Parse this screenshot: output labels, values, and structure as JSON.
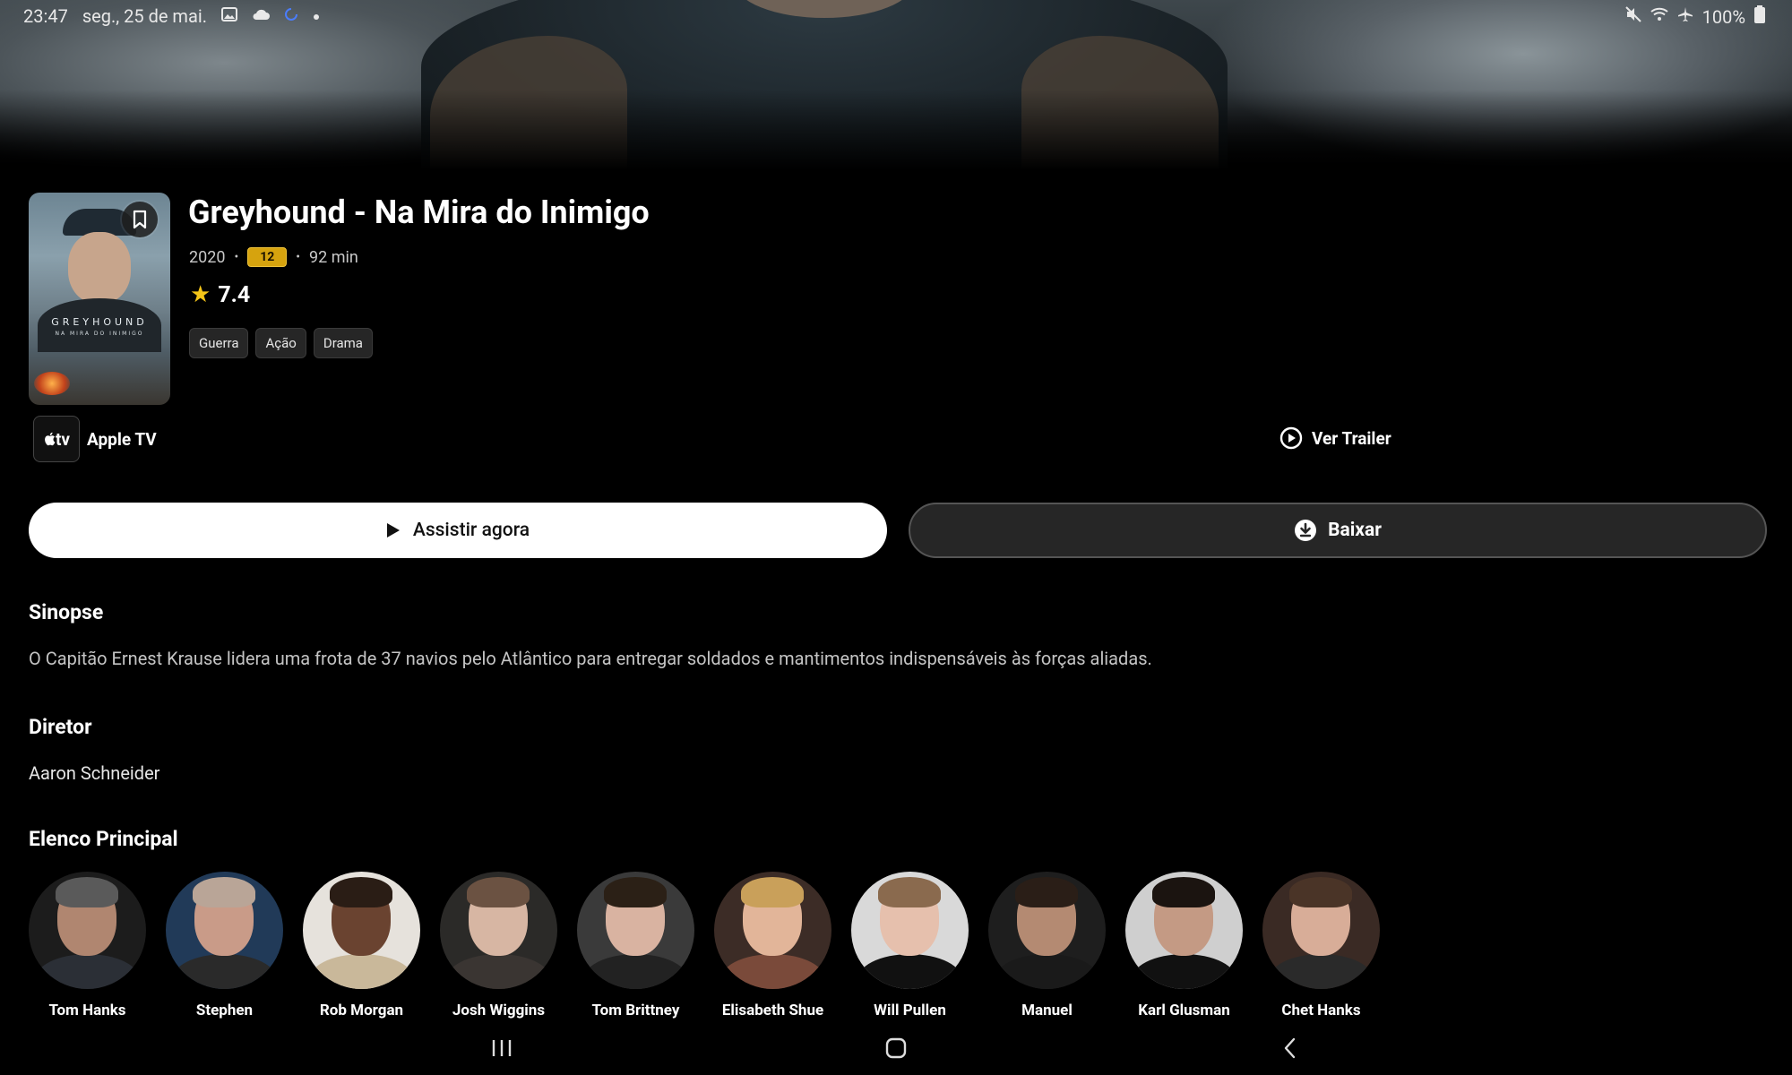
{
  "status_bar": {
    "time": "23:47",
    "date": "seg., 25 de mai.",
    "icons_left": [
      "image-icon",
      "cloud-icon",
      "sync-icon",
      "dot-icon"
    ],
    "icons_right": [
      "mute-icon",
      "wifi-icon",
      "airplane-icon",
      "battery-icon"
    ],
    "battery": "100%"
  },
  "movie": {
    "title": "Greyhound - Na Mira do Inimigo",
    "year": "2020",
    "age_rating": "12",
    "duration": "92 min",
    "rating": "7.4",
    "genres": [
      "Guerra",
      "Ação",
      "Drama"
    ],
    "poster_title": "GREYHOUND",
    "poster_subtitle": "NA MIRA DO INIMIGO"
  },
  "provider": {
    "logo_text": "tv",
    "name": "Apple TV"
  },
  "trailer": {
    "label": "Ver Trailer"
  },
  "actions": {
    "watch_label": "Assistir agora",
    "download_label": "Baixar"
  },
  "sections": {
    "synopsis_title": "Sinopse",
    "synopsis_text": "O Capitão Ernest Krause lidera uma frota de 37 navios pelo Atlântico para entregar soldados e mantimentos indispensáveis às forças aliadas.",
    "director_title": "Diretor",
    "director_name": "Aaron Schneider",
    "cast_title": "Elenco Principal"
  },
  "cast": [
    {
      "name": "Tom Hanks",
      "bg": "#1c1c1c",
      "skin": "#b08670",
      "hair": "#5a5a5a",
      "clothes": "#2b2f36"
    },
    {
      "name": "Stephen",
      "bg": "#213a58",
      "skin": "#c99b88",
      "hair": "#b9a597",
      "clothes": "#2a2a2a"
    },
    {
      "name": "Rob Morgan",
      "bg": "#e6e2dc",
      "skin": "#6a4330",
      "hair": "#2a1d15",
      "clothes": "#c9b89a"
    },
    {
      "name": "Josh Wiggins",
      "bg": "#2b2a28",
      "skin": "#d7b6a3",
      "hair": "#6b5242",
      "clothes": "#3a3532"
    },
    {
      "name": "Tom Brittney",
      "bg": "#3a3a3a",
      "skin": "#d9b3a1",
      "hair": "#2b2016",
      "clothes": "#222"
    },
    {
      "name": "Elisabeth Shue",
      "bg": "#3c2c26",
      "skin": "#e2b599",
      "hair": "#c9a05a",
      "clothes": "#7a4a3a"
    },
    {
      "name": "Will Pullen",
      "bg": "#d9d9d9",
      "skin": "#e6c0ad",
      "hair": "#8a6a4e",
      "clothes": "#111"
    },
    {
      "name": "Manuel",
      "bg": "#1e1e1e",
      "skin": "#b48a72",
      "hair": "#2a1e17",
      "clothes": "#1a1a1a"
    },
    {
      "name": "Karl Glusman",
      "bg": "#cfcfcf",
      "skin": "#c49a84",
      "hair": "#1b1410",
      "clothes": "#111"
    },
    {
      "name": "Chet Hanks",
      "bg": "#3a2a24",
      "skin": "#d8ad98",
      "hair": "#4a3427",
      "clothes": "#2a2a2a"
    }
  ],
  "nav_bar": {
    "buttons": [
      "recent-apps-icon",
      "home-icon",
      "back-icon"
    ]
  }
}
